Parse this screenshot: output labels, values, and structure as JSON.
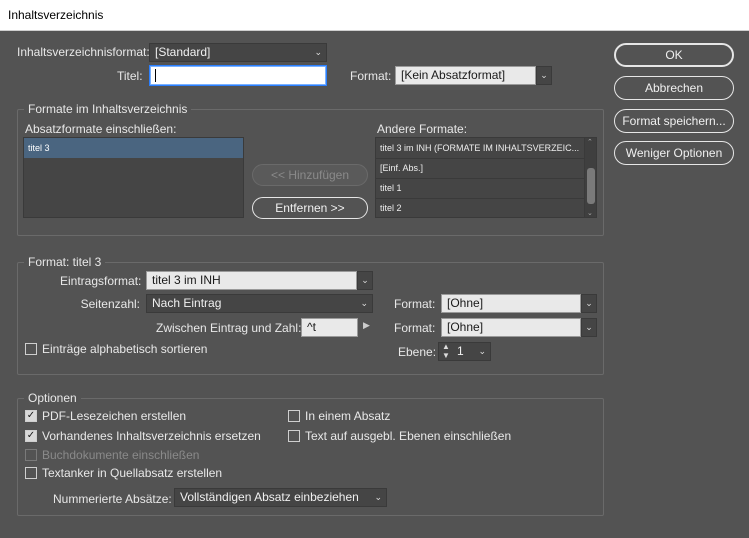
{
  "window": {
    "title": "Inhaltsverzeichnis"
  },
  "top": {
    "format_label": "Inhaltsverzeichnisformat:",
    "format_value": "[Standard]",
    "title_label": "Titel:",
    "title_value": "",
    "format2_label": "Format:",
    "format2_value": "[Kein Absatzformat]"
  },
  "buttons": {
    "ok": "OK",
    "cancel": "Abbrechen",
    "save_format": "Format speichern...",
    "fewer_options": "Weniger Optionen",
    "add": "<< Hinzufügen",
    "remove": "Entfernen >>"
  },
  "formats_group": {
    "title": "Formate im Inhaltsverzeichnis",
    "include_label": "Absatzformate einschließen:",
    "include_items": [
      "titel 3"
    ],
    "other_label": "Andere Formate:",
    "other_items": [
      "titel 3 im INH (FORMATE IM INHALTSVERZEIC...",
      "[Einf. Abs.]",
      "titel 1",
      "titel 2"
    ]
  },
  "format_group": {
    "title": "Format: titel 3",
    "entry_format_label": "Eintragsformat:",
    "entry_format_value": "titel 3 im INH",
    "page_number_label": "Seitenzahl:",
    "page_number_value": "Nach Eintrag",
    "page_number_format_label": "Format:",
    "page_number_format_value": "[Ohne]",
    "between_label": "Zwischen Eintrag und Zahl:",
    "between_value": "^t",
    "between_format_label": "Format:",
    "between_format_value": "[Ohne]",
    "sort_label": "Einträge alphabetisch sortieren",
    "level_label": "Ebene:",
    "level_value": "1"
  },
  "options_group": {
    "title": "Optionen",
    "pdf_bookmarks": "PDF-Lesezeichen erstellen",
    "replace_toc": "Vorhandenes Inhaltsverzeichnis ersetzen",
    "book_docs": "Buchdokumente einschließen",
    "text_anchor": "Textanker in Quellabsatz erstellen",
    "one_paragraph": "In einem Absatz",
    "hidden_layers": "Text auf ausgebl. Ebenen einschließen",
    "numbered_label": "Nummerierte Absätze:",
    "numbered_value": "Vollständigen Absatz einbeziehen"
  }
}
